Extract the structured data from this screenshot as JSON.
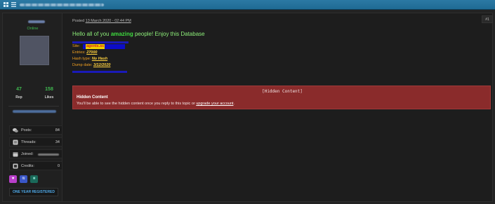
{
  "topbar": {
    "icons": [
      "grid-icon",
      "menu-icon"
    ]
  },
  "sidebar": {
    "status": "Online",
    "stats": [
      {
        "value": "47",
        "label": "Rep"
      },
      {
        "value": "158",
        "label": "Likes"
      }
    ],
    "rows": [
      {
        "icon": "chat-icon",
        "label": "Posts:",
        "value": "84"
      },
      {
        "icon": "threads-icon",
        "label": "Threads:",
        "value": "34"
      },
      {
        "icon": "calendar-icon",
        "label": "Joined:",
        "value": ""
      },
      {
        "icon": "credits-icon",
        "label": "Credits:",
        "value": "0"
      }
    ],
    "badges": [
      {
        "icon": "heart-badge-icon",
        "bg": "#b83fc9",
        "fg": "#ffffff"
      },
      {
        "icon": "wifi-badge-icon",
        "bg": "#3a56c7",
        "fg": "#ffffff"
      },
      {
        "icon": "square-badge-icon",
        "bg": "#1a6a5a",
        "fg": "#7fd0c0"
      }
    ],
    "button_label": "ONE YEAR REGISTERED"
  },
  "post": {
    "posted_prefix": "Posted",
    "posted_date": "13 March 2020 - 02:44 PM",
    "post_number": "#1",
    "greeting_a": "Hello all of you",
    "greeting_highlight": "amazing",
    "greeting_b": "people! Enjoy this Database",
    "site_label": "Site:",
    "site_value": "agents.sc",
    "entries_label": "Entries:",
    "entries_value": "27000",
    "hash_label": "Hash type:",
    "hash_value": "No Hash",
    "dump_label": "Dump date:",
    "dump_value": "3/12/2020"
  },
  "hidden": {
    "title": "[Hidden Content]",
    "heading": "Hidden Content",
    "message": "You'll be able to see the hidden content once you reply to this topic or",
    "link": "upgrade your account",
    "suffix": "."
  },
  "colors": {
    "accent_blue": "#2b79a4",
    "online_green": "#3fb950",
    "hidden_red": "#8a2b2b",
    "field_orange": "#f0a020",
    "value_yellow": "#ffd23f"
  }
}
